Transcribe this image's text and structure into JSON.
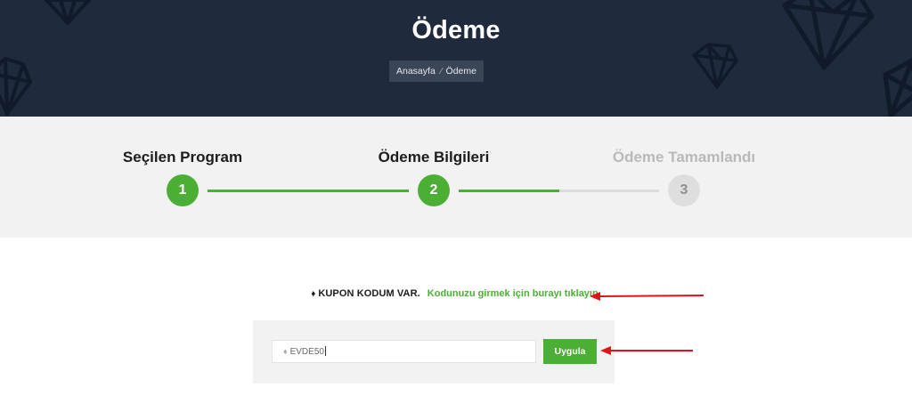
{
  "header": {
    "title": "Ödeme",
    "breadcrumb": {
      "home": "Anasayfa",
      "separator": "⁄",
      "current": "Ödeme"
    }
  },
  "steps": [
    {
      "label": "Seçilen Program",
      "number": "1",
      "state": "done"
    },
    {
      "label": "Ödeme Bilgileri",
      "number": "2",
      "state": "active"
    },
    {
      "label": "Ödeme Tamamlandı",
      "number": "3",
      "state": "pending"
    }
  ],
  "progress": {
    "segment_1_to_2": 1.0,
    "segment_2_to_3": 0.5
  },
  "coupon": {
    "icon": "tag-icon",
    "question": "KUPON KODUM VAR.",
    "link_text": "Kodunuzu girmek için burayı tıklayın.",
    "input_value": "EVDE50",
    "apply_label": "Uygula"
  },
  "colors": {
    "header_bg": "#1f2a3d",
    "accent": "#4caf35",
    "annotation_arrow": "#e0131a"
  }
}
